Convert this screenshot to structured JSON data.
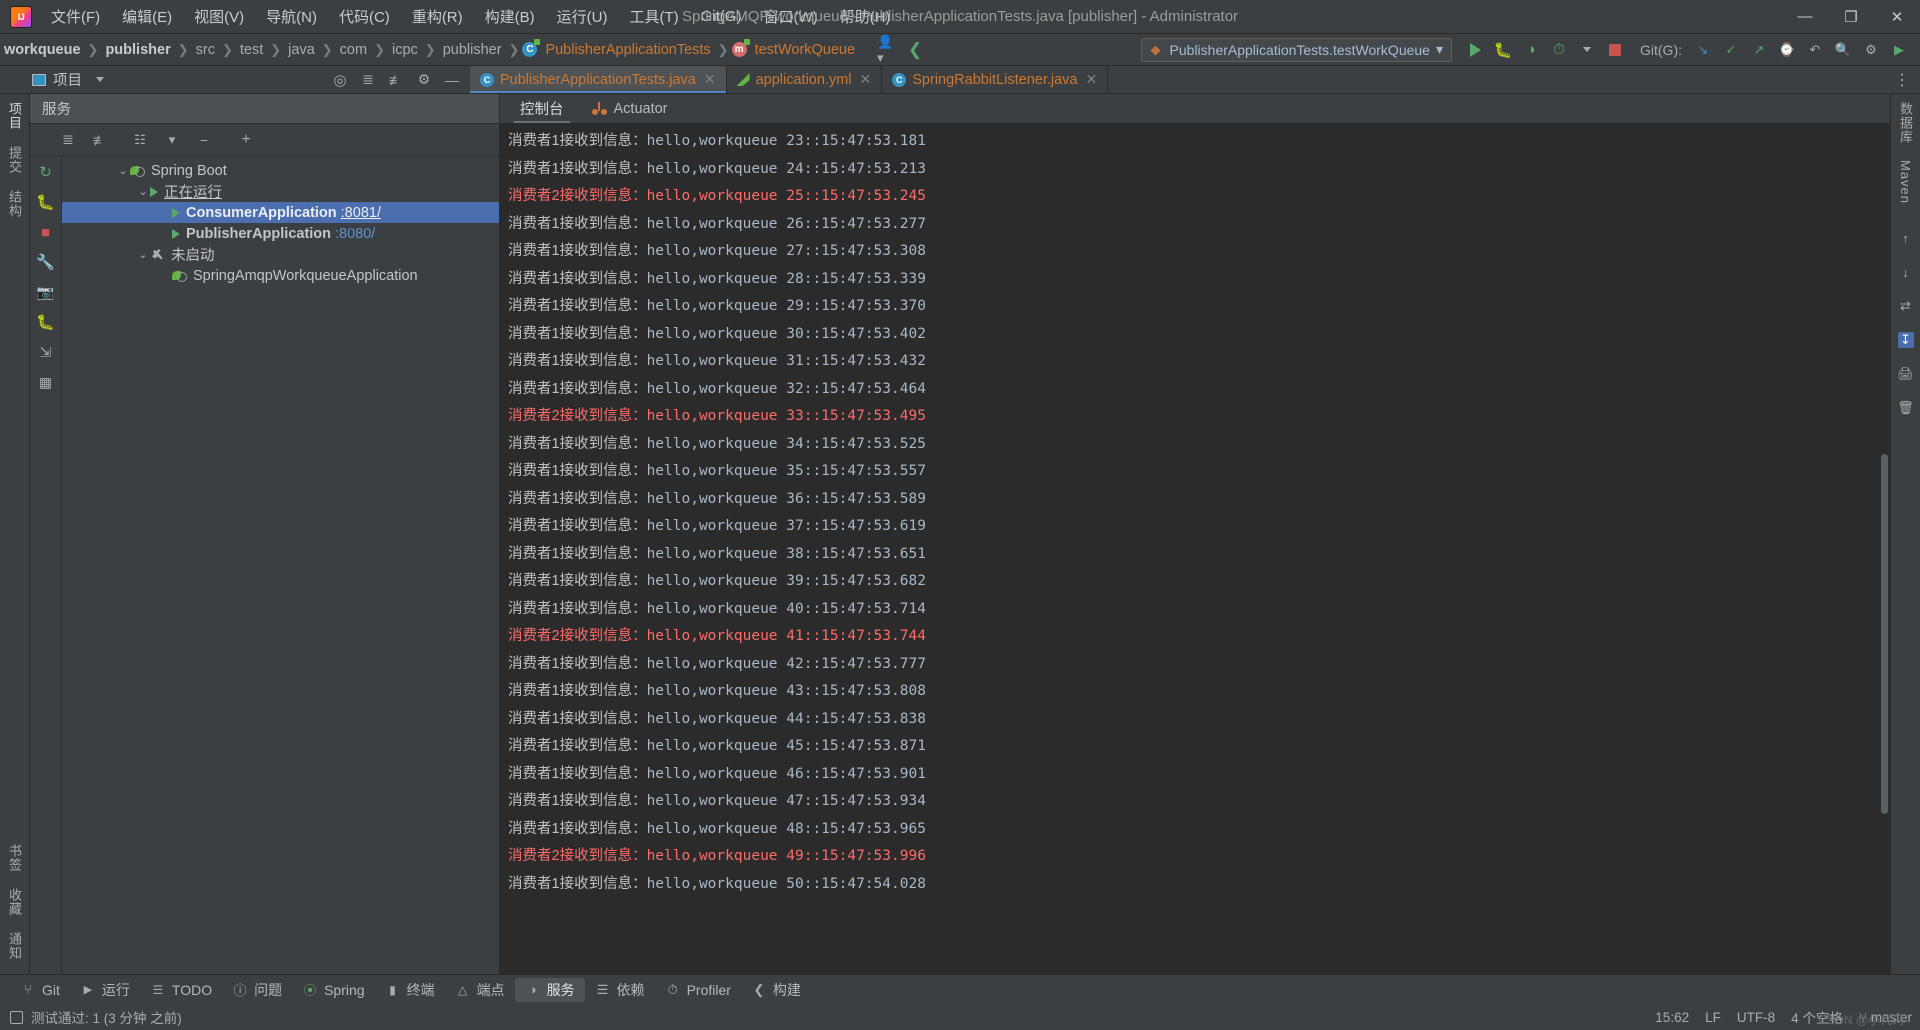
{
  "window": {
    "title": "SpringAMQP-workqueue - PublisherApplicationTests.java [publisher] - Administrator",
    "minimize": "—",
    "maximize": "❐",
    "close": "✕"
  },
  "menu": {
    "items": [
      {
        "label": "文件(F)"
      },
      {
        "label": "编辑(E)"
      },
      {
        "label": "视图(V)"
      },
      {
        "label": "导航(N)"
      },
      {
        "label": "代码(C)"
      },
      {
        "label": "重构(R)"
      },
      {
        "label": "构建(B)"
      },
      {
        "label": "运行(U)"
      },
      {
        "label": "工具(T)"
      },
      {
        "label": "Git(G)"
      },
      {
        "label": "窗口(W)"
      },
      {
        "label": "帮助(H)"
      }
    ]
  },
  "breadcrumbs": {
    "items": [
      {
        "label": "workqueue",
        "style": "bold"
      },
      {
        "label": "publisher",
        "style": "bold"
      },
      {
        "label": "src",
        "style": "plain"
      },
      {
        "label": "test",
        "style": "plain"
      },
      {
        "label": "java",
        "style": "plain"
      },
      {
        "label": "com",
        "style": "plain"
      },
      {
        "label": "icpc",
        "style": "plain"
      },
      {
        "label": "publisher",
        "style": "plain"
      },
      {
        "label": "PublisherApplicationTests",
        "style": "class"
      },
      {
        "label": "testWorkQueue",
        "style": "method"
      }
    ],
    "separator": "❯"
  },
  "toolbar": {
    "run_config": "PublisherApplicationTests.testWorkQueue",
    "run_config_caret": "▾",
    "run_button": "run-button",
    "debug_button": "debug-button",
    "coverage_button": "run-with-coverage-button",
    "profiler_button": "profiler-button",
    "stop_button": "stop-button",
    "git_label": "Git(G):",
    "search_icon": "🔍",
    "settings_icon": "⚙",
    "update_icon": "↻"
  },
  "tool_window_header": {
    "project_label": "项目",
    "caret": "▾",
    "icons": [
      "target-icon",
      "collapse-all-icon",
      "expand-all-icon",
      "gear-icon",
      "hide-icon"
    ]
  },
  "editor_tabs": {
    "tabs": [
      {
        "label": "PublisherApplicationTests.java",
        "icon": "java-class-icon",
        "active": true,
        "close": "✕"
      },
      {
        "label": "application.yml",
        "icon": "yaml-leaf-icon",
        "active": false,
        "close": "✕"
      },
      {
        "label": "SpringRabbitListener.java",
        "icon": "java-class-icon",
        "active": false,
        "close": "✕"
      }
    ],
    "more": "⋮"
  },
  "left_rail": {
    "items": [
      {
        "label": "项目",
        "selected": true
      },
      {
        "label": "提交",
        "selected": false
      },
      {
        "label": "结构",
        "selected": false
      }
    ],
    "bottom_items": [
      {
        "label": "书签"
      },
      {
        "label": "收藏"
      },
      {
        "label": "通知"
      }
    ]
  },
  "right_rail": {
    "items": [
      {
        "label": "数据库"
      },
      {
        "label": "Maven"
      }
    ]
  },
  "services": {
    "header": "服务",
    "toolbar_icons": [
      "collapse-all-icon",
      "expand-all-icon",
      "group-by-icon",
      "filter-icon",
      "show-console-icon",
      "add-icon"
    ],
    "action_icons": [
      "rerun-icon",
      "debug-icon",
      "stop-icon",
      "wrench-icon",
      "screenshot-icon",
      "attach-icon",
      "export-icon",
      "grid-icon"
    ],
    "tree": [
      {
        "level": 0,
        "chevron": "⌄",
        "icon": "spring-boot-icon",
        "label": "Spring Boot",
        "underline": false,
        "bold": false,
        "port": "",
        "selected": false
      },
      {
        "level": 1,
        "chevron": "⌄",
        "icon": "run-triangle-icon",
        "label": "正在运行",
        "underline": true,
        "bold": false,
        "port": "",
        "selected": false
      },
      {
        "level": 2,
        "chevron": "",
        "icon": "run-triangle-icon",
        "label": "ConsumerApplication",
        "underline": false,
        "bold": true,
        "port": ":8081/",
        "port_underline": true,
        "selected": true
      },
      {
        "level": 2,
        "chevron": "",
        "icon": "run-triangle-icon",
        "label": "PublisherApplication",
        "underline": false,
        "bold": true,
        "port": ":8080/",
        "port_underline": false,
        "selected": false
      },
      {
        "level": 1,
        "chevron": "⌄",
        "icon": "wrench-icon",
        "label": "未启动",
        "underline": false,
        "bold": false,
        "port": "",
        "selected": false
      },
      {
        "level": 2,
        "chevron": "",
        "icon": "spring-boot-icon",
        "label": "SpringAmqpWorkqueueApplication",
        "underline": false,
        "bold": false,
        "port": "",
        "selected": false
      }
    ]
  },
  "console": {
    "tabs": [
      {
        "label": "控制台",
        "icon": "",
        "active": true
      },
      {
        "label": "Actuator",
        "icon": "actuator-icon",
        "active": false
      }
    ],
    "lines": [
      {
        "consumer": "消费者1接收到信息：",
        "message": "hello,workqueue 23::15:47:53.181",
        "error": false
      },
      {
        "consumer": "消费者1接收到信息：",
        "message": "hello,workqueue 24::15:47:53.213",
        "error": false
      },
      {
        "consumer": "消费者2接收到信息：",
        "message": "hello,workqueue 25::15:47:53.245",
        "error": true
      },
      {
        "consumer": "消费者1接收到信息：",
        "message": "hello,workqueue 26::15:47:53.277",
        "error": false
      },
      {
        "consumer": "消费者1接收到信息：",
        "message": "hello,workqueue 27::15:47:53.308",
        "error": false
      },
      {
        "consumer": "消费者1接收到信息：",
        "message": "hello,workqueue 28::15:47:53.339",
        "error": false
      },
      {
        "consumer": "消费者1接收到信息：",
        "message": "hello,workqueue 29::15:47:53.370",
        "error": false
      },
      {
        "consumer": "消费者1接收到信息：",
        "message": "hello,workqueue 30::15:47:53.402",
        "error": false
      },
      {
        "consumer": "消费者1接收到信息：",
        "message": "hello,workqueue 31::15:47:53.432",
        "error": false
      },
      {
        "consumer": "消费者1接收到信息：",
        "message": "hello,workqueue 32::15:47:53.464",
        "error": false
      },
      {
        "consumer": "消费者2接收到信息：",
        "message": "hello,workqueue 33::15:47:53.495",
        "error": true
      },
      {
        "consumer": "消费者1接收到信息：",
        "message": "hello,workqueue 34::15:47:53.525",
        "error": false
      },
      {
        "consumer": "消费者1接收到信息：",
        "message": "hello,workqueue 35::15:47:53.557",
        "error": false
      },
      {
        "consumer": "消费者1接收到信息：",
        "message": "hello,workqueue 36::15:47:53.589",
        "error": false
      },
      {
        "consumer": "消费者1接收到信息：",
        "message": "hello,workqueue 37::15:47:53.619",
        "error": false
      },
      {
        "consumer": "消费者1接收到信息：",
        "message": "hello,workqueue 38::15:47:53.651",
        "error": false
      },
      {
        "consumer": "消费者1接收到信息：",
        "message": "hello,workqueue 39::15:47:53.682",
        "error": false
      },
      {
        "consumer": "消费者1接收到信息：",
        "message": "hello,workqueue 40::15:47:53.714",
        "error": false
      },
      {
        "consumer": "消费者2接收到信息：",
        "message": "hello,workqueue 41::15:47:53.744",
        "error": true
      },
      {
        "consumer": "消费者1接收到信息：",
        "message": "hello,workqueue 42::15:47:53.777",
        "error": false
      },
      {
        "consumer": "消费者1接收到信息：",
        "message": "hello,workqueue 43::15:47:53.808",
        "error": false
      },
      {
        "consumer": "消费者1接收到信息：",
        "message": "hello,workqueue 44::15:47:53.838",
        "error": false
      },
      {
        "consumer": "消费者1接收到信息：",
        "message": "hello,workqueue 45::15:47:53.871",
        "error": false
      },
      {
        "consumer": "消费者1接收到信息：",
        "message": "hello,workqueue 46::15:47:53.901",
        "error": false
      },
      {
        "consumer": "消费者1接收到信息：",
        "message": "hello,workqueue 47::15:47:53.934",
        "error": false
      },
      {
        "consumer": "消费者1接收到信息：",
        "message": "hello,workqueue 48::15:47:53.965",
        "error": false
      },
      {
        "consumer": "消费者2接收到信息：",
        "message": "hello,workqueue 49::15:47:53.996",
        "error": true
      },
      {
        "consumer": "消费者1接收到信息：",
        "message": "hello,workqueue 50::15:47:54.028",
        "error": false
      }
    ]
  },
  "bottom_toolbar": {
    "items": [
      {
        "label": "Git",
        "icon": "git-icon",
        "active": false
      },
      {
        "label": "运行",
        "icon": "run-icon",
        "active": false
      },
      {
        "label": "TODO",
        "icon": "todo-icon",
        "active": false
      },
      {
        "label": "问题",
        "icon": "problems-icon",
        "active": false
      },
      {
        "label": "Spring",
        "icon": "spring-icon",
        "active": false
      },
      {
        "label": "终端",
        "icon": "terminal-icon",
        "active": false
      },
      {
        "label": "端点",
        "icon": "endpoints-icon",
        "active": false
      },
      {
        "label": "服务",
        "icon": "services-icon",
        "active": true
      },
      {
        "label": "依赖",
        "icon": "dependencies-icon",
        "active": false
      },
      {
        "label": "Profiler",
        "icon": "profiler-icon",
        "active": false
      },
      {
        "label": "构建",
        "icon": "build-icon",
        "active": false
      }
    ]
  },
  "statusbar": {
    "message": "测试通过: 1 (3 分钟 之前)",
    "time": "15:62",
    "line_sep": "LF",
    "encoding": "UTF-8",
    "indent": "4 个空格",
    "branch": "master",
    "watermark": "CSDN @小代码"
  },
  "colors": {
    "accent": "#4b6eaf",
    "error": "#ff6b68",
    "link": "#5a94d1",
    "green": "#59a869",
    "bg": "#3c3f41",
    "console_bg": "#2b2b2b"
  }
}
